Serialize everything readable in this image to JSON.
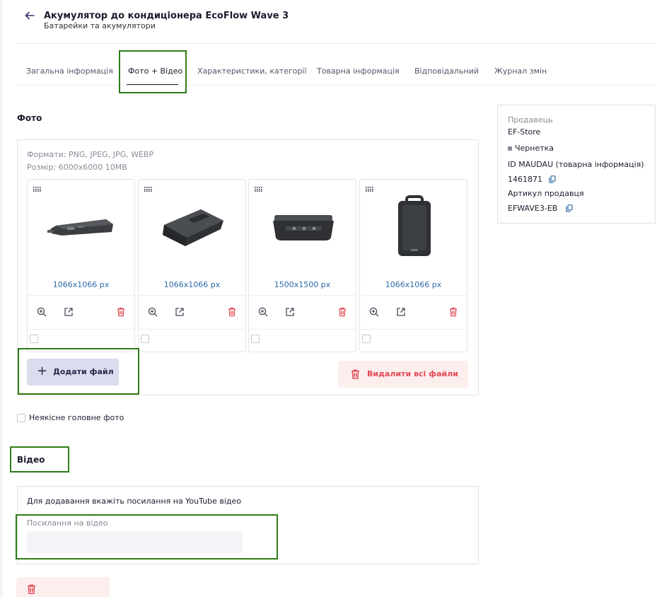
{
  "header": {
    "title": "Акумулятор до кондиціонера EcoFlow Wave 3",
    "subtitle": "Батарейки та акумулятори"
  },
  "tabs": [
    {
      "label": "Загальна інформація"
    },
    {
      "label": "Фото + Відео"
    },
    {
      "label": "Характеристики, категорії"
    },
    {
      "label": "Товарна інформація"
    },
    {
      "label": "Відповідальний"
    },
    {
      "label": "Журнал змін"
    }
  ],
  "photo": {
    "section_title": "Фото",
    "formats": "Формати: PNG, JPEG, JPG, WEBP",
    "size": "Розмір: 6000x6000 10MB",
    "images": [
      {
        "dimensions": "1066x1066 px"
      },
      {
        "dimensions": "1066x1066 px"
      },
      {
        "dimensions": "1500x1500 px"
      },
      {
        "dimensions": "1066x1066 px"
      }
    ],
    "add_button": "Додати файл",
    "delete_all_button": "Видалити всі файли",
    "low_quality_label": "Неякісне головне фото"
  },
  "video": {
    "section_title": "Відео",
    "hint": "Для додавання вкажіть посилання на YouTube відео",
    "link_label": "Посилання на відео",
    "link_value": ""
  },
  "seller": {
    "seller_label": "Продавець",
    "seller_name": "EF-Store",
    "status": "Чернетка",
    "id_label": "ID MAUDAU (товарна інформація)",
    "id_value": "1461871",
    "sku_label": "Артикул продавця",
    "sku_value": "EFWAVE3-EB"
  },
  "colors": {
    "accent": "#2a2a4a",
    "highlight": "#2e7d16",
    "danger": "#e24a55",
    "link": "#2f6aa8"
  }
}
